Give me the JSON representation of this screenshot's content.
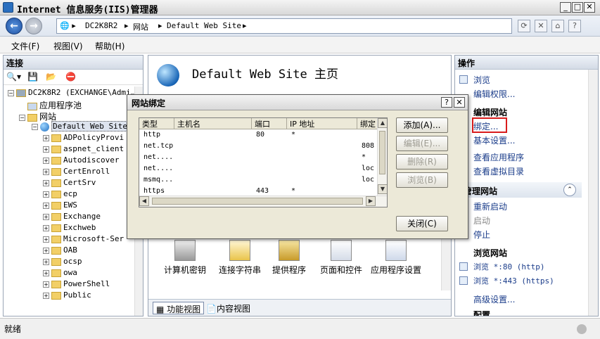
{
  "window": {
    "title": "Internet 信息服务(IIS)管理器"
  },
  "address": {
    "crumbs": [
      "DC2K8R2",
      "网站",
      "Default Web Site"
    ]
  },
  "menu": [
    "文件(F)",
    "视图(V)",
    "帮助(H)"
  ],
  "connections": {
    "header": "连接",
    "server": "DC2K8R2 (EXCHANGE\\Admi…",
    "app_pools": "应用程序池",
    "sites": "网站",
    "site": "Default Web Site",
    "children": [
      "ADPolicyProvi",
      "aspnet_client",
      "Autodiscover",
      "CertEnroll",
      "CertSrv",
      "ecp",
      "EWS",
      "Exchange",
      "Exchweb",
      "Microsoft-Ser",
      "OAB",
      "ocsp",
      "owa",
      "PowerShell",
      "Public"
    ]
  },
  "center": {
    "title": "Default Web Site 主页",
    "features": [
      "计算机密钥",
      "连接字符串",
      "提供程序",
      "页面和控件",
      "应用程序设置"
    ],
    "tabs": [
      "功能视图",
      "内容视图"
    ]
  },
  "actions": {
    "header": "操作",
    "items1": [
      "浏览",
      "编辑权限..."
    ],
    "edit_site": "编辑网站",
    "binding": "绑定...",
    "basic_settings": "基本设置...",
    "view_apps": "查看应用程序",
    "view_vdirs": "查看虚拟目录",
    "manage_site": "管理网站",
    "restart": "重新启动",
    "start": "启动",
    "stop": "停止",
    "browse_site": "浏览网站",
    "browse80": "浏览 *:80 (http)",
    "browse443": "浏览 *:443 (https)",
    "advanced": "高级设置...",
    "config": "配置"
  },
  "status": "就绪",
  "dialog": {
    "title": "网站绑定",
    "columns": [
      "类型",
      "主机名",
      "端口",
      "IP 地址",
      "绑定"
    ],
    "rows": [
      [
        "http",
        "",
        "80",
        "*",
        ""
      ],
      [
        "net.tcp",
        "",
        "",
        "",
        "808"
      ],
      [
        "net....",
        "",
        "",
        "",
        "*"
      ],
      [
        "net....",
        "",
        "",
        "",
        "loc"
      ],
      [
        "msmq...",
        "",
        "",
        "",
        "loc"
      ],
      [
        "https",
        "",
        "443",
        "*",
        ""
      ]
    ],
    "buttons": {
      "add": "添加(A)...",
      "edit": "编辑(E)...",
      "remove": "删除(R)",
      "browse": "浏览(B)",
      "close": "关闭(C)"
    }
  }
}
